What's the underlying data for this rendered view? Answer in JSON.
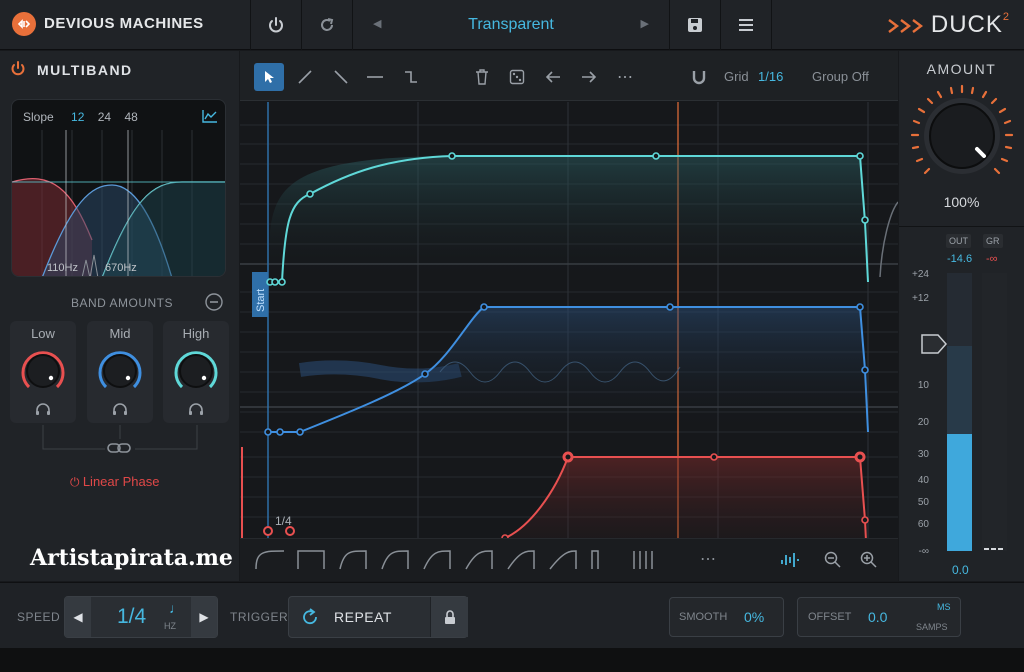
{
  "topbar": {
    "brand": "DEVIOUS MACHINES",
    "preset_name": "Transparent",
    "product": "DUCK",
    "product_version": "2",
    "icons": [
      "power-icon",
      "redo-icon",
      "prev-preset-icon",
      "next-preset-icon",
      "save-icon",
      "menu-icon"
    ]
  },
  "multiband": {
    "title": "MULTIBAND",
    "slope_label": "Slope",
    "slope_options": [
      "12",
      "24",
      "48"
    ],
    "slope_selected": "12",
    "crossover_low": "110Hz",
    "crossover_high": "670Hz",
    "band_amounts_label": "BAND AMOUNTS",
    "bands": [
      {
        "label": "Low",
        "color": "#e85050"
      },
      {
        "label": "Mid",
        "color": "#3f8fe0"
      },
      {
        "label": "High",
        "color": "#5fd8d8"
      }
    ],
    "linear_phase": "Linear Phase"
  },
  "graph_toolbar": {
    "grid_label": "Grid",
    "grid_value": "1/16",
    "group_label": "Group Off"
  },
  "graph": {
    "start_label": "Start",
    "marker_label": "1/4"
  },
  "amount": {
    "label": "AMOUNT",
    "value": "100%"
  },
  "meter": {
    "out_label": "OUT",
    "gr_label": "GR",
    "out_value": "-14.6",
    "gr_value": "-∞",
    "scale": [
      "+24",
      "+12",
      "10",
      "20",
      "30",
      "40",
      "50",
      "60",
      "-∞"
    ],
    "bottom_value": "0.0"
  },
  "bottom": {
    "speed_label": "SPEED",
    "speed_value": "1/4",
    "speed_unit": "HZ",
    "trigger_label": "TRIGGER",
    "trigger_mode": "REPEAT",
    "smooth_label": "SMOOTH",
    "smooth_value": "0%",
    "offset_label": "OFFSET",
    "offset_value": "0.0",
    "offset_unit_top": "MS",
    "offset_unit_bottom": "SAMPS"
  },
  "watermark": "Artistapirata.me",
  "colors": {
    "accent_orange": "#e8703a",
    "cyan": "#5fd8d8",
    "blue": "#3f8fe0",
    "red": "#e85050",
    "text_blue": "#46b8e0"
  }
}
